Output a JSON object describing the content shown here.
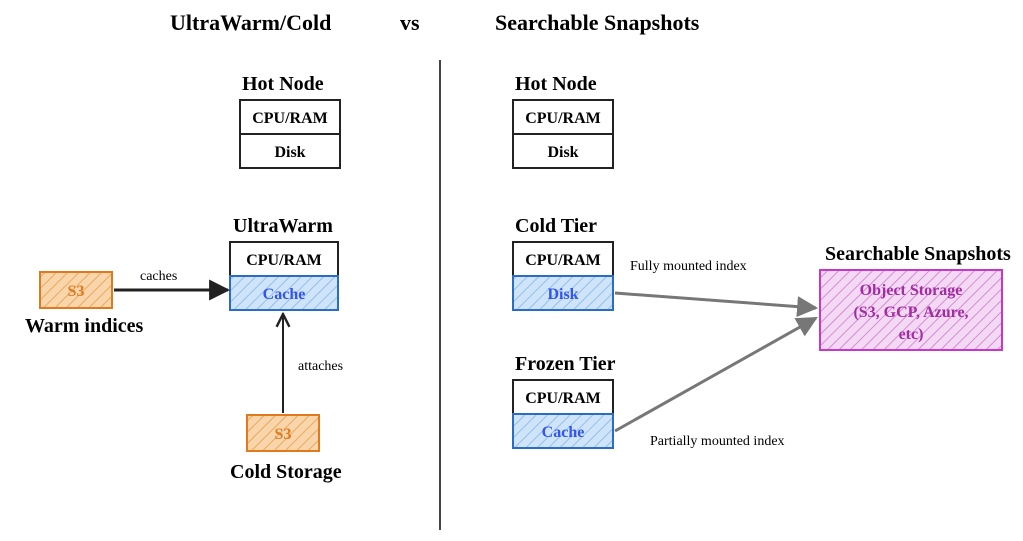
{
  "title_left": "UltraWarm/Cold",
  "title_vs": "vs",
  "title_right": "Searchable Snapshots",
  "left": {
    "hot_node": {
      "heading": "Hot Node",
      "row1": "CPU/RAM",
      "row2": "Disk"
    },
    "ultrawarm": {
      "heading": "UltraWarm",
      "row1": "CPU/RAM",
      "row2": "Cache"
    },
    "s3_warm": "S3",
    "warm_indices_label": "Warm indices",
    "arrow_caches": "caches",
    "arrow_attaches": "attaches",
    "s3_cold": "S3",
    "cold_storage_label": "Cold Storage"
  },
  "right": {
    "hot_node": {
      "heading": "Hot Node",
      "row1": "CPU/RAM",
      "row2": "Disk"
    },
    "cold_tier": {
      "heading": "Cold Tier",
      "row1": "CPU/RAM",
      "row2": "Disk"
    },
    "frozen_tier": {
      "heading": "Frozen Tier",
      "row1": "CPU/RAM",
      "row2": "Cache"
    },
    "fully_mounted": "Fully mounted index",
    "partially_mounted": "Partially mounted index",
    "snapshots_heading": "Searchable Snapshots",
    "object_storage_l1": "Object Storage",
    "object_storage_l2": "(S3, GCP, Azure,",
    "object_storage_l3": "etc)"
  }
}
